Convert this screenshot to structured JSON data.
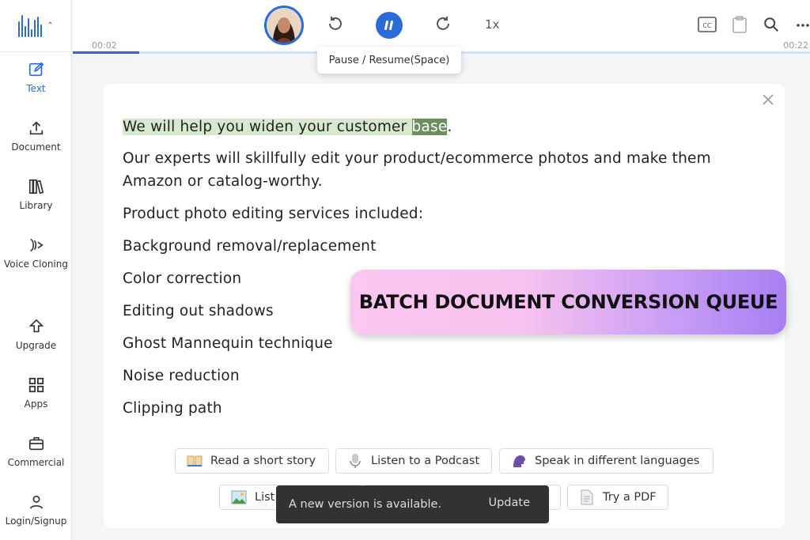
{
  "sidebar": {
    "items": [
      {
        "label": "Text"
      },
      {
        "label": "Document"
      },
      {
        "label": "Library"
      },
      {
        "label": "Voice Cloning"
      },
      {
        "label": "Upgrade"
      },
      {
        "label": "Apps"
      },
      {
        "label": "Commercial"
      },
      {
        "label": "Login/Signup"
      }
    ]
  },
  "player": {
    "speed": "1x",
    "time_elapsed": "00:02",
    "time_total": "00:22",
    "progress_fraction": 0.09,
    "tooltip": "Pause / Resume(Space)"
  },
  "content": {
    "sentence_before": "We will help you widen your customer ",
    "highlight_word": "base",
    "sentence_after": ".",
    "paragraphs": [
      "Our experts will skillfully edit your product/ecommerce photos and make them",
      "Amazon or catalog-worthy.",
      "Product photo editing services included:",
      "Background removal/replacement",
      "Color correction",
      "Editing out shadows",
      "Ghost Mannequin technique",
      "Noise reduction",
      "Clipping path"
    ]
  },
  "suggestions": {
    "row1": [
      "Read a short story",
      "Listen to a Podcast",
      "Speak in different languages"
    ],
    "row2_first": "List",
    "row2_last": "Try a PDF"
  },
  "snackbar": {
    "message": "A new version is available.",
    "action": "Update"
  },
  "banner": {
    "text": "BATCH DOCUMENT CONVERSION QUEUE"
  },
  "colors": {
    "accent": "#2a6bd8",
    "highlight_sentence": "#d7e8cf",
    "highlight_word": "#6b8f5e"
  }
}
